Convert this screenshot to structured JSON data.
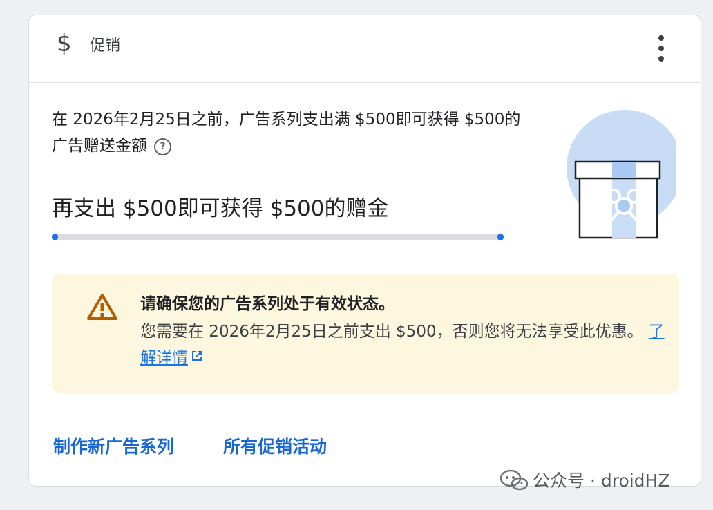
{
  "header": {
    "icon": "dollar-icon",
    "title": "促销",
    "more_icon": "more-vertical-icon"
  },
  "promotion": {
    "description": "在 2026年2月25日之前，广告系列支出满 $500即可获得 $500的广告赠送金额",
    "help_icon": "?"
  },
  "progress": {
    "label": "再支出 $500即可获得 $500的赠金",
    "value": 0
  },
  "notice": {
    "icon": "warning-triangle-icon",
    "title": "请确保您的广告系列处于有效状态。",
    "body": "您需要在 2026年2月25日之前支出 $500，否则您将无法享受此优惠。",
    "link_text": "了解详情",
    "link_icon": "external-link-icon"
  },
  "actions": {
    "create_campaign": "制作新广告系列",
    "all_promotions": "所有促销活动"
  },
  "watermark": {
    "text": "公众号 · droidHZ",
    "icon": "wechat-icon"
  },
  "colors": {
    "accent": "#1a73e8",
    "link": "#1967d2",
    "notice_background": "#fef7e0",
    "warning": "#b06000",
    "gift_circle": "#c8dcf6"
  }
}
